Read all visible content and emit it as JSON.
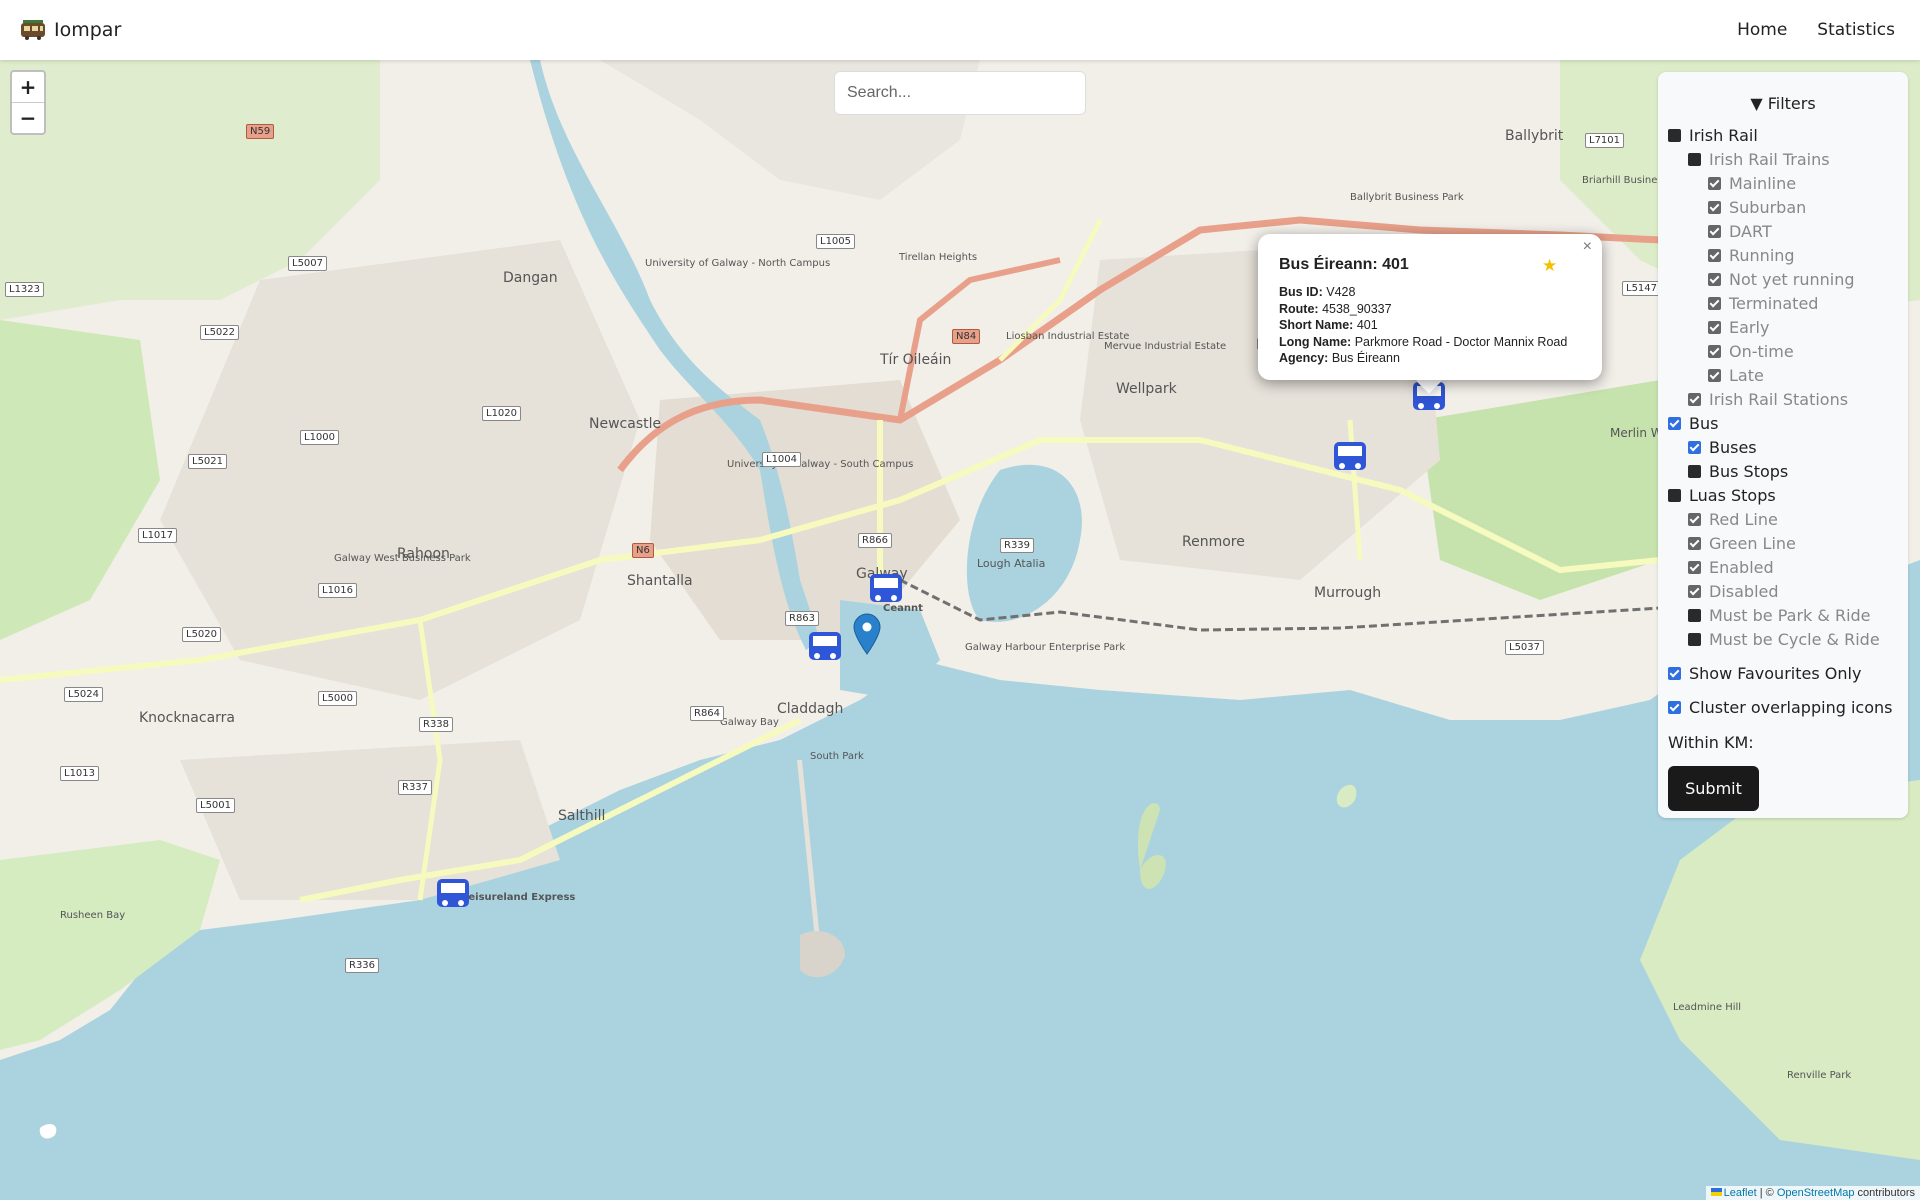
{
  "nav": {
    "brand": "Iompar",
    "links": [
      "Home",
      "Statistics"
    ]
  },
  "search": {
    "placeholder": "Search..."
  },
  "zoom": {
    "in": "+",
    "out": "−"
  },
  "filters": {
    "title": "▼ Filters",
    "items": [
      {
        "label": "Irish Rail",
        "state": "off",
        "dim": false
      },
      {
        "label": "Irish Rail Trains",
        "state": "off",
        "dim": true
      },
      {
        "label": "Mainline",
        "state": "grey",
        "dim": true
      },
      {
        "label": "Suburban",
        "state": "grey",
        "dim": true
      },
      {
        "label": "DART",
        "state": "grey",
        "dim": true
      },
      {
        "label": "Running",
        "state": "grey",
        "dim": true
      },
      {
        "label": "Not yet running",
        "state": "grey",
        "dim": true
      },
      {
        "label": "Terminated",
        "state": "grey",
        "dim": true
      },
      {
        "label": "Early",
        "state": "grey",
        "dim": true
      },
      {
        "label": "On-time",
        "state": "grey",
        "dim": true
      },
      {
        "label": "Late",
        "state": "grey",
        "dim": true
      },
      {
        "label": "Irish Rail Stations",
        "state": "grey",
        "dim": true
      },
      {
        "label": "Bus",
        "state": "on",
        "dim": false
      },
      {
        "label": "Buses",
        "state": "on",
        "dim": false
      },
      {
        "label": "Bus Stops",
        "state": "off",
        "dim": false
      },
      {
        "label": "Luas Stops",
        "state": "off",
        "dim": false
      },
      {
        "label": "Red Line",
        "state": "grey",
        "dim": true
      },
      {
        "label": "Green Line",
        "state": "grey",
        "dim": true
      },
      {
        "label": "Enabled",
        "state": "grey",
        "dim": true
      },
      {
        "label": "Disabled",
        "state": "grey",
        "dim": true
      },
      {
        "label": "Must be Park & Ride",
        "state": "off",
        "dim": true
      },
      {
        "label": "Must be Cycle & Ride",
        "state": "off",
        "dim": true
      },
      {
        "label": "Show Favourites Only",
        "state": "on",
        "dim": false
      },
      {
        "label": "Cluster overlapping icons",
        "state": "on",
        "dim": false
      }
    ],
    "within_label": "Within KM:",
    "submit_label": "Submit"
  },
  "popup": {
    "title": "Bus Éireann: 401",
    "close": "×",
    "star": "★",
    "fields": [
      {
        "key": "Bus ID:",
        "value": "V428"
      },
      {
        "key": "Route:",
        "value": "4538_90337"
      },
      {
        "key": "Short Name:",
        "value": "401"
      },
      {
        "key": "Long Name:",
        "value": "Parkmore Road - Doctor Mannix Road"
      },
      {
        "key": "Agency:",
        "value": "Bus Éireann"
      }
    ]
  },
  "attribution": {
    "leaflet": "Leaflet",
    "sep": " | © ",
    "osm": "OpenStreetMap",
    "tail": " contributors"
  },
  "map_labels": [
    "Ballybrit",
    "Dangan",
    "Newcastle",
    "Tír Oileáin",
    "Wellpark",
    "Merv",
    "Renmore",
    "Murrough",
    "Rahoon",
    "Shantalla",
    "Galway",
    "Claddagh",
    "Knocknacarra",
    "Salthill",
    "Lough Atalia",
    "Merlin Woods",
    "University of Galway - North Campus",
    "University of Galway - South Campus",
    "Galway West Business Park",
    "Ballybrit Business Park",
    "Briarhill Business Park",
    "Tirellan Heights",
    "Liosban Industrial Estate",
    "Mervue Industrial Estate",
    "Galway Harbour Enterprise Park",
    "South Park",
    "Leadmine Hill",
    "Renville Park",
    "Rusheen Bay",
    "Galway Bay",
    "Ceannt",
    "Leisureland Express"
  ],
  "road_labels": [
    "N59",
    "L5007",
    "L1323",
    "L5022",
    "L1000",
    "L1020",
    "L5021",
    "L1017",
    "L1016",
    "L5020",
    "L5024",
    "L5000",
    "L1013",
    "L5001",
    "R338",
    "R337",
    "R336",
    "N6",
    "R866",
    "R863",
    "R864",
    "R339",
    "N84",
    "L1004",
    "L1005",
    "L5037",
    "L5147",
    "L7101"
  ],
  "colors": {
    "water": "#aad3df",
    "land": "#f2efe9",
    "green": "#c8e6b0",
    "road": "#f7fabf",
    "major": "#e8a08a",
    "bus": "#2f56d6",
    "marker": "#2a81cb"
  }
}
